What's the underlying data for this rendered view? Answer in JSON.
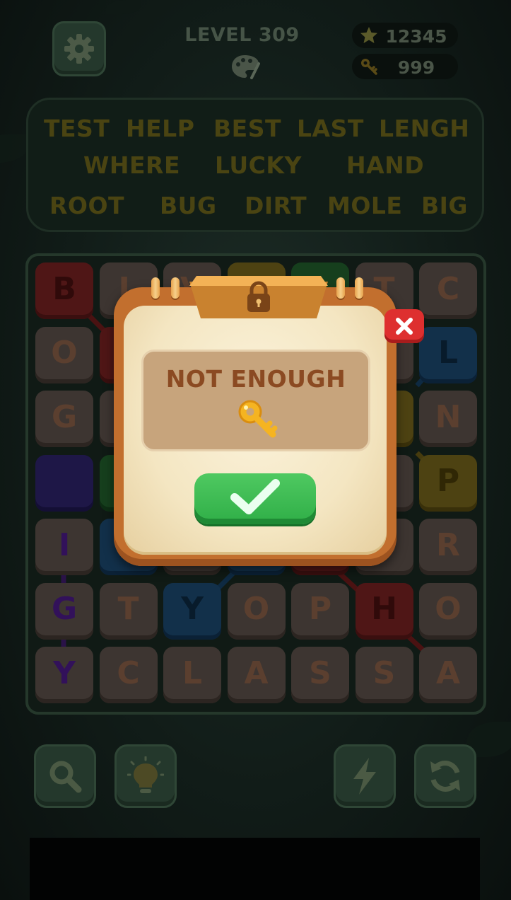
{
  "header": {
    "level_label": "LEVEL 309",
    "stars": "12345",
    "keys": "999"
  },
  "word_list": [
    "TEST",
    "HELP",
    "BEST",
    "LAST",
    "LENGH",
    "WHERE",
    "LUCKY",
    "HAND",
    "ROOT",
    "BUG",
    "DIRT",
    "MOLE",
    "BIG"
  ],
  "grid": {
    "rows": [
      [
        "B",
        "L",
        "V",
        "",
        "",
        "T",
        "C"
      ],
      [
        "O",
        "",
        "",
        "",
        "",
        "",
        "L"
      ],
      [
        "G",
        "",
        "",
        "",
        "",
        "",
        "N"
      ],
      [
        "",
        "",
        "",
        "",
        "",
        "",
        "P"
      ],
      [
        "I",
        "",
        "",
        "",
        "",
        "O",
        "R"
      ],
      [
        "G",
        "T",
        "Y",
        "O",
        "P",
        "H",
        "O"
      ],
      [
        "Y",
        "C",
        "L",
        "A",
        "S",
        "S",
        "A"
      ]
    ]
  },
  "dialog": {
    "message": "NOT ENOUGH",
    "icon": "key-icon",
    "confirm_icon": "checkmark-icon",
    "close_icon": "close-icon",
    "lock_icon": "lock-icon"
  },
  "toolbar": {
    "buttons": [
      "search-icon",
      "lightbulb-icon",
      "lightning-icon",
      "refresh-icon"
    ]
  },
  "colors": {
    "dialog_frame": "#c26f2e",
    "dialog_paper": "#f4e6c2",
    "confirm_green": "#2fae47",
    "close_red": "#de2f2f",
    "message_text": "#8b4a22"
  }
}
